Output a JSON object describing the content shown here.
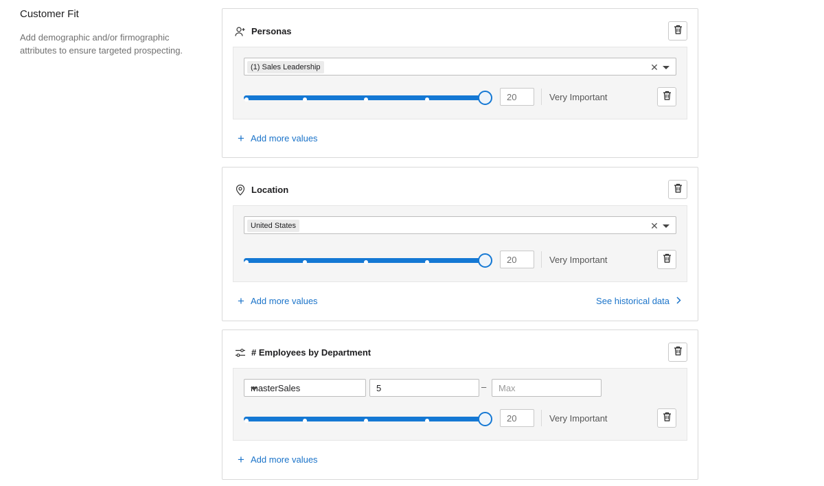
{
  "section": {
    "title": "Customer Fit",
    "description": "Add demographic and/or firmographic attributes to ensure targeted prospecting."
  },
  "cards": {
    "personas": {
      "title": "Personas",
      "icon": "person-add-icon",
      "tag": "(1) Sales Leadership",
      "weight": "20",
      "importance": "Very Important",
      "add_more": "Add more values"
    },
    "location": {
      "title": "Location",
      "icon": "location-pin-icon",
      "tag": "United States",
      "weight": "20",
      "importance": "Very Important",
      "add_more": "Add more values",
      "historical_link": "See historical data"
    },
    "employees": {
      "title": "# Employees by Department",
      "icon": "sliders-icon",
      "department": "masterSales",
      "min_value": "5",
      "max_placeholder": "Max",
      "range_separator": "–",
      "weight": "20",
      "importance": "Very Important",
      "add_more": "Add more values"
    }
  },
  "slider": {
    "level": 1.0,
    "steps": 5
  },
  "colors": {
    "accent": "#1478d4",
    "link": "#1a73c9",
    "panel_bg": "#f5f5f5"
  }
}
